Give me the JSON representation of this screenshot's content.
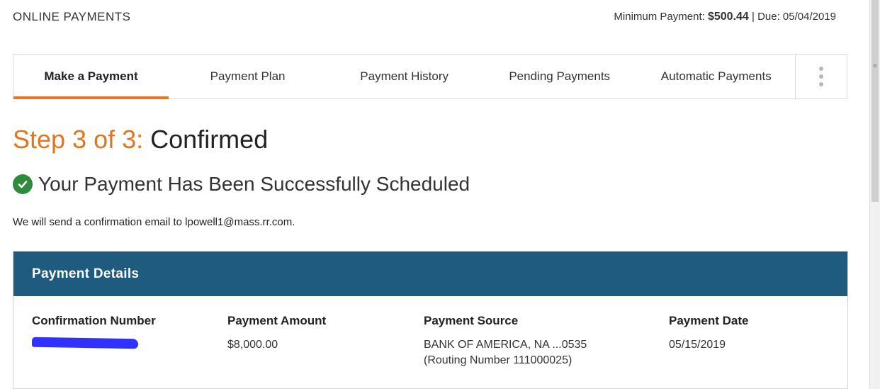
{
  "header": {
    "title": "ONLINE PAYMENTS",
    "min_payment_label": "Minimum Payment:",
    "min_payment_value": "$500.44",
    "separator": "|",
    "due_label": "Due:",
    "due_value": "05/04/2019"
  },
  "tabs": [
    {
      "label": "Make a Payment",
      "active": true
    },
    {
      "label": "Payment Plan",
      "active": false
    },
    {
      "label": "Payment History",
      "active": false
    },
    {
      "label": "Pending Payments",
      "active": false
    },
    {
      "label": "Automatic Payments",
      "active": false
    }
  ],
  "more_icon": "vertical-ellipsis-icon",
  "step": {
    "prefix": "Step 3 of 3:",
    "title": "Confirmed"
  },
  "success": {
    "icon": "check-circle-icon",
    "message": "Your Payment Has Been Successfully Scheduled"
  },
  "email_note": "We will send a confirmation email to lpowell1@mass.rr.com.",
  "details": {
    "title": "Payment Details",
    "columns": [
      {
        "label": "Confirmation Number",
        "value": "[redacted]"
      },
      {
        "label": "Payment Amount",
        "value": "$8,000.00"
      },
      {
        "label": "Payment Source",
        "value": "BANK OF AMERICA, NA ...0535",
        "value2": "(Routing Number 111000025)"
      },
      {
        "label": "Payment Date",
        "value": "05/15/2019"
      }
    ]
  },
  "colors": {
    "accent_orange": "#e87722",
    "header_blue": "#1e5b7e",
    "success_green": "#2e8b3e"
  }
}
